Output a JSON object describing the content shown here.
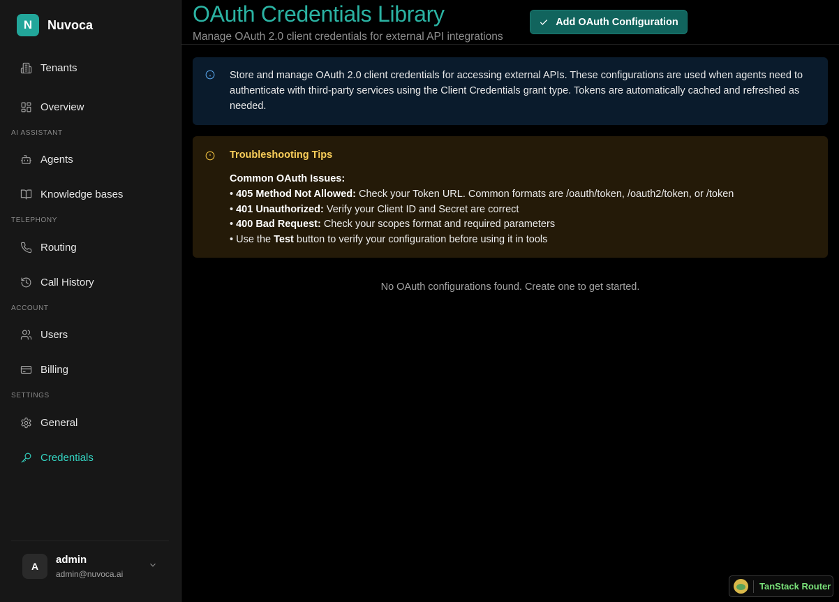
{
  "brand": {
    "logo_letter": "N",
    "name": "Nuvoca"
  },
  "sidebar": {
    "items": [
      {
        "label": "Tenants",
        "icon": "building-icon"
      },
      {
        "label": "Overview",
        "icon": "layout-grid-icon"
      },
      {
        "label": "Agents",
        "icon": "bot-icon"
      },
      {
        "label": "Knowledge bases",
        "icon": "book-open-icon"
      },
      {
        "label": "Routing",
        "icon": "phone-icon"
      },
      {
        "label": "Call History",
        "icon": "history-icon"
      },
      {
        "label": "Users",
        "icon": "users-icon"
      },
      {
        "label": "Billing",
        "icon": "credit-card-icon"
      },
      {
        "label": "General",
        "icon": "gear-icon"
      },
      {
        "label": "Credentials",
        "icon": "key-icon",
        "active": true
      }
    ],
    "sections": {
      "ai_assistant": "AI ASSISTANT",
      "telephony": "TELEPHONY",
      "account": "ACCOUNT",
      "settings": "SETTINGS"
    },
    "user": {
      "avatar_letter": "A",
      "name": "admin",
      "email": "admin@nuvoca.ai"
    }
  },
  "header": {
    "title": "OAuth Credentials Library",
    "subtitle": "Manage OAuth 2.0 client credentials for external API integrations",
    "add_button_label": "Add OAuth Configuration"
  },
  "info": {
    "text": "Store and manage OAuth 2.0 client credentials for accessing external APIs. These configurations are used when agents need to authenticate with third-party services using the Client Credentials grant type. Tokens are automatically cached and refreshed as needed."
  },
  "tips": {
    "title": "Troubleshooting Tips",
    "heading": "Common OAuth Issues:",
    "items": [
      {
        "bullet": "• ",
        "strong": "405 Method Not Allowed:",
        "text": " Check your Token URL. Common formats are /oauth/token, /oauth2/token, or /token"
      },
      {
        "bullet": "• ",
        "strong": "401 Unauthorized:",
        "text": " Verify your Client ID and Secret are correct"
      },
      {
        "bullet": "• ",
        "strong": "400 Bad Request:",
        "text": " Check your scopes format and required parameters"
      },
      {
        "bullet": "• ",
        "pre": "Use the ",
        "strong": "Test",
        "text": " button to verify your configuration before using it in tools"
      }
    ]
  },
  "empty_state": "No OAuth configurations found. Create one to get started.",
  "devtools": {
    "label": "TanStack Router"
  },
  "colors": {
    "accent": "#2bb3a3",
    "active_nav": "#34d3c1",
    "button": "#11645d",
    "info_bg": "#0a1b2c",
    "tips_bg": "#241a08",
    "tips_title": "#fbcf5a"
  }
}
